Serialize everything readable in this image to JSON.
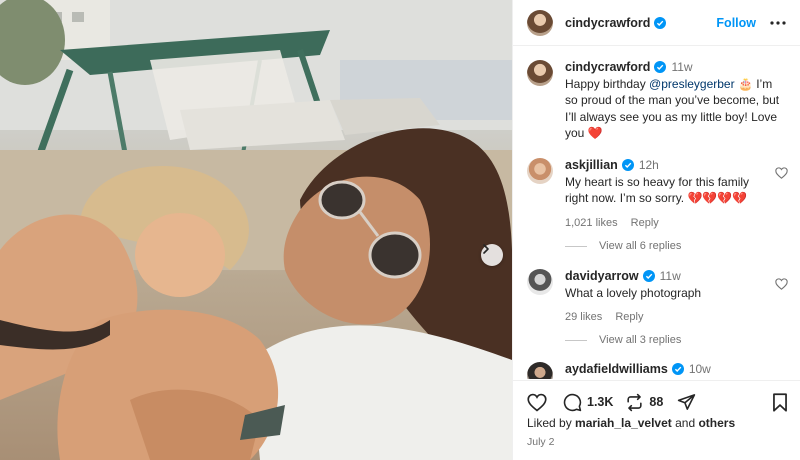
{
  "post": {
    "author": "cindycrawford",
    "follow_label": "Follow",
    "caption": {
      "username": "cindycrawford",
      "time": "11w",
      "text_before": "Happy birthday ",
      "mention": "@presleygerber",
      "text_after": " 🎂 I’m so proud of the man you’ve become, but I’ll always see you as my little boy! Love you ❤️"
    },
    "likes_count": "1.3K",
    "reposts_count": "88",
    "liked_by_prefix": "Liked by ",
    "liked_by_user": "mariah_la_velvet",
    "liked_by_and": " and ",
    "liked_by_others": "others",
    "date": "July 2"
  },
  "comments": [
    {
      "username": "askjillian",
      "time": "12h",
      "text": "My heart is so heavy for this family right now. I’m so sorry. 💔💔💔💔",
      "likes": "1,021 likes",
      "reply_label": "Reply",
      "view_replies": "View all 6 replies"
    },
    {
      "username": "davidyarrow",
      "time": "11w",
      "text": "What a lovely photograph",
      "likes": "29 likes",
      "reply_label": "Reply",
      "view_replies": "View all 3 replies"
    },
    {
      "username": "aydafieldwilliams",
      "time": "10w"
    }
  ],
  "colors": {
    "accent": "#0095f6",
    "verified": "#0095f6",
    "muted": "#737373",
    "text": "#262626"
  },
  "icons": [
    "verified-badge-icon",
    "more-options-icon",
    "heart-icon",
    "comment-icon",
    "repost-icon",
    "share-icon",
    "bookmark-icon",
    "chevron-right-icon"
  ]
}
